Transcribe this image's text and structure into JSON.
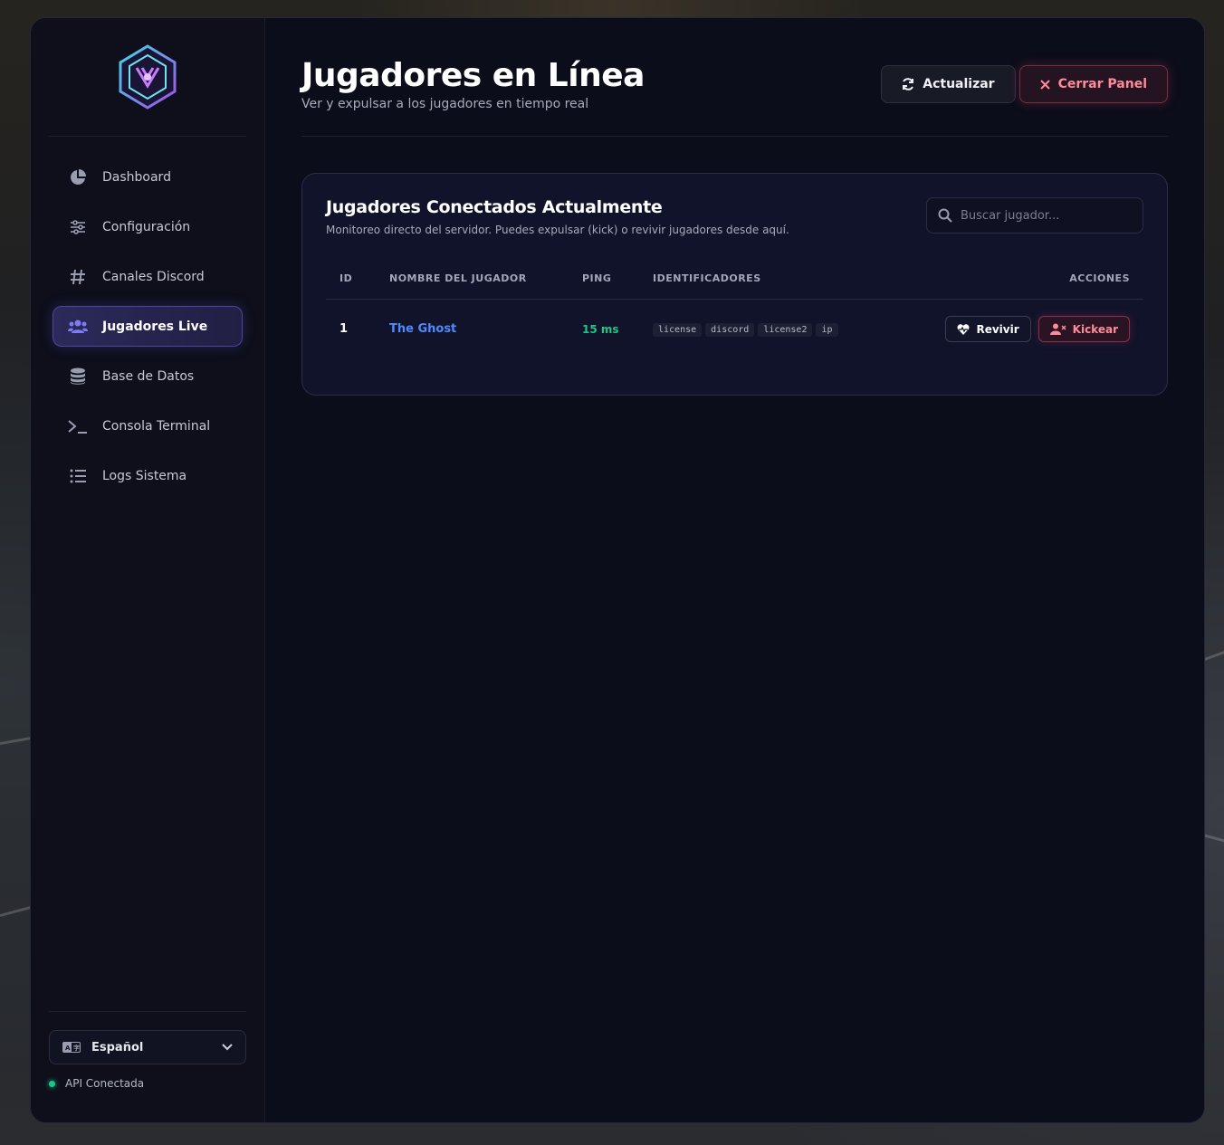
{
  "sidebar": {
    "items": [
      {
        "label": "Dashboard",
        "icon": "pie-chart-icon"
      },
      {
        "label": "Configuración",
        "icon": "sliders-icon"
      },
      {
        "label": "Canales Discord",
        "icon": "hash-icon"
      },
      {
        "label": "Jugadores Live",
        "icon": "users-icon",
        "active": true
      },
      {
        "label": "Base de Datos",
        "icon": "database-icon"
      },
      {
        "label": "Consola Terminal",
        "icon": "terminal-icon"
      },
      {
        "label": "Logs Sistema",
        "icon": "list-icon"
      }
    ],
    "language": "Español",
    "api_status": "API Conectada"
  },
  "header": {
    "title": "Jugadores en Línea",
    "subtitle": "Ver y expulsar a los jugadores en tiempo real",
    "refresh_label": "Actualizar",
    "close_label": "Cerrar Panel"
  },
  "card": {
    "title": "Jugadores Conectados Actualmente",
    "subtitle": "Monitoreo directo del servidor. Puedes expulsar (kick) o revivir jugadores desde aquí.",
    "search_placeholder": "Buscar jugador...",
    "columns": [
      "ID",
      "NOMBRE DEL JUGADOR",
      "PING",
      "IDENTIFICADORES",
      "ACCIONES"
    ],
    "rows": [
      {
        "id": "1",
        "name": "The Ghost",
        "ping": "15 ms",
        "identifiers": [
          "license",
          "discord",
          "license2",
          "ip"
        ],
        "revive_label": "Revivir",
        "kick_label": "Kickear"
      }
    ]
  },
  "colors": {
    "accent": "#4a47a0",
    "link": "#4b8bff",
    "success": "#1fc587",
    "danger": "#ff8a9a"
  }
}
